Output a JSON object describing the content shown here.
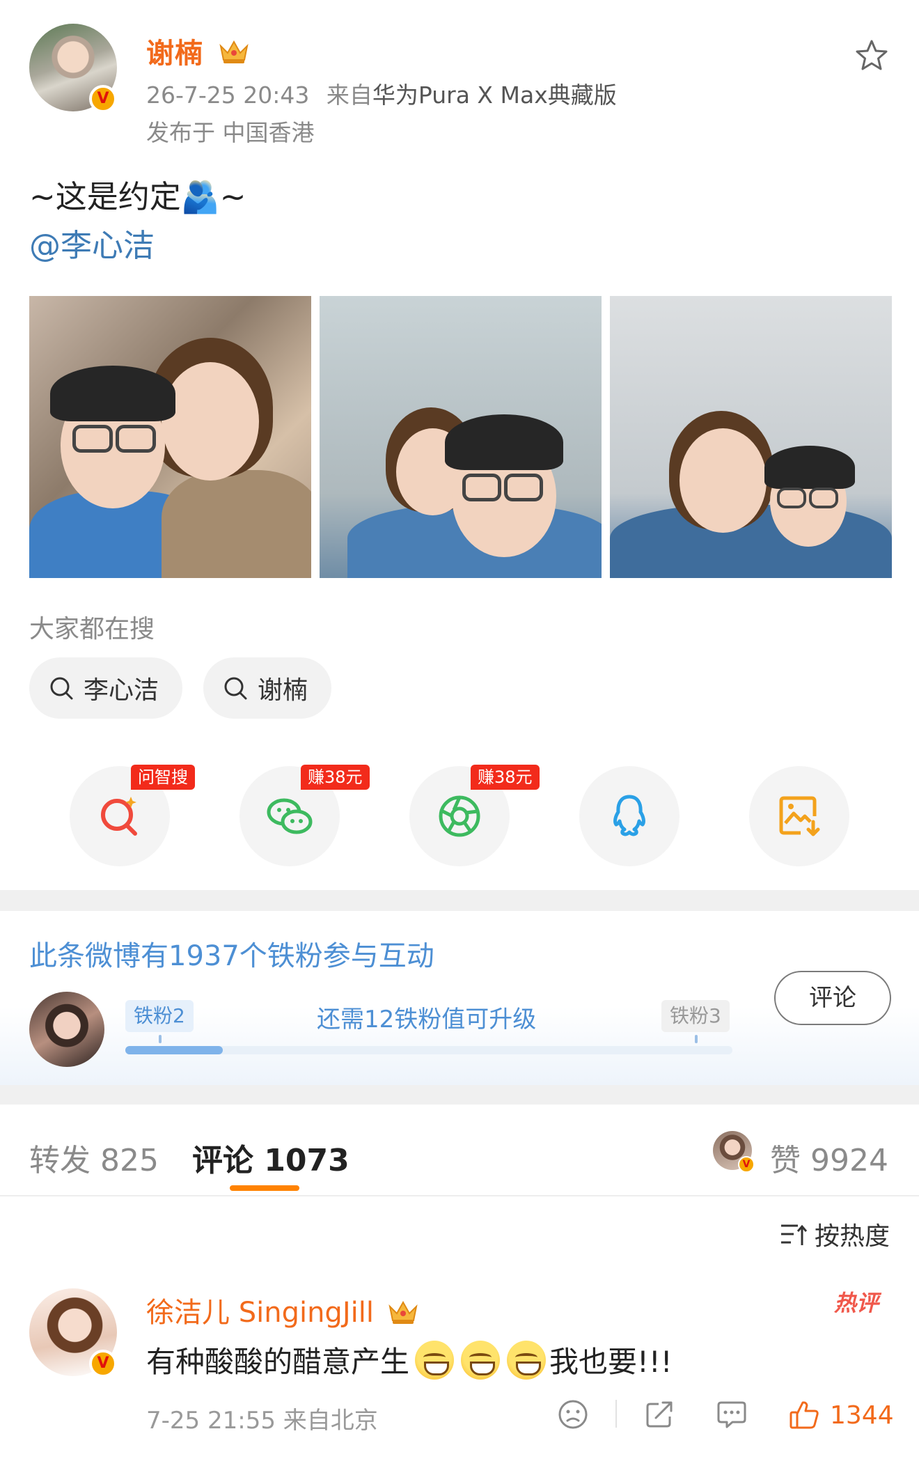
{
  "post": {
    "author": "谢楠",
    "time": "26-7-25 20:43",
    "source_prefix": "来自",
    "source": "华为Pura X Max典藏版",
    "location": "发布于 中国香港",
    "text": "~这是约定🫂~",
    "mention": "@李心洁",
    "photo_count": 3
  },
  "hot_search": {
    "title": "大家都在搜",
    "chips": [
      "李心洁",
      "谢楠"
    ]
  },
  "share": {
    "buttons": [
      {
        "icon": "zhisou-search-icon",
        "tag": "问智搜",
        "color": "#f04a3c"
      },
      {
        "icon": "wechat-icon",
        "tag": "赚38元",
        "color": "#3dba5f"
      },
      {
        "icon": "moments-icon",
        "tag": "赚38元",
        "color": "#3dba5f"
      },
      {
        "icon": "qq-icon",
        "tag": "",
        "color": "#2aa0e6"
      },
      {
        "icon": "save-image-icon",
        "tag": "",
        "color": "#f3a21c"
      }
    ]
  },
  "fans": {
    "title": "此条微博有1937个铁粉参与互动",
    "level_current": "铁粉2",
    "level_next": "铁粉3",
    "hint": "还需12铁粉值可升级",
    "progress": 0.16,
    "comment_button": "评论"
  },
  "tabs": {
    "repost": "转发 825",
    "comment": "评论 1073",
    "like": "赞 9924"
  },
  "sort_label": "按热度",
  "comment": {
    "author": "徐洁儿 SingingJill",
    "hot_badge": "热评",
    "text_before": "有种酸酸的醋意产生",
    "emoji_count": 3,
    "text_after": "我也要!!!",
    "meta": "7-25 21:55 来自北京",
    "likes": "1344"
  },
  "colors": {
    "orange": "#f26a1b",
    "link_blue": "#3e7bb5",
    "fan_blue": "#4d8fd4",
    "tab_underline": "#ff8200",
    "promo_red": "#f22b1b"
  }
}
